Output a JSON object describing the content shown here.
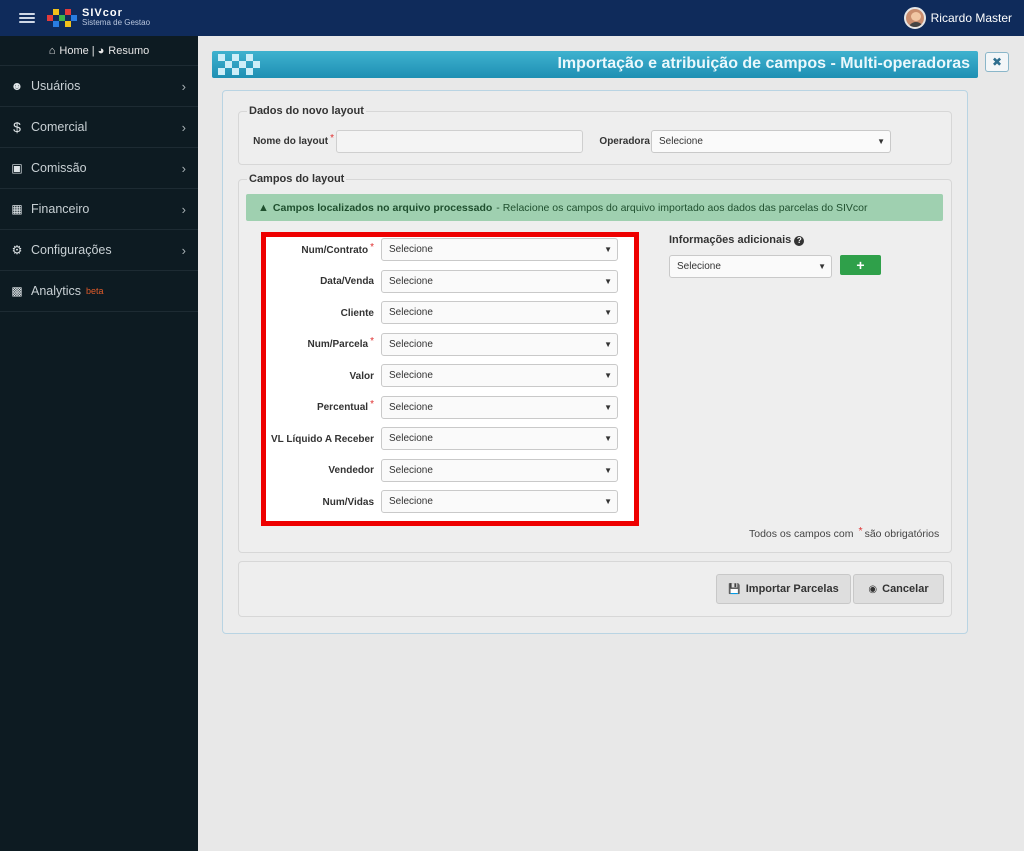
{
  "app": {
    "brand_name": "SIVcor",
    "brand_sub": "Sistema de Gestao",
    "user_name": "Ricardo Master"
  },
  "sidebar": {
    "home_label": "Home",
    "separator": "|",
    "summary_label": "Resumo",
    "items": [
      {
        "label": "Usuários",
        "icon": "users-icon"
      },
      {
        "label": "Comercial",
        "icon": "dollar-icon"
      },
      {
        "label": "Comissão",
        "icon": "money-icon"
      },
      {
        "label": "Financeiro",
        "icon": "briefcase-icon"
      },
      {
        "label": "Configurações",
        "icon": "gears-icon"
      },
      {
        "label": "Analytics",
        "icon": "bar-chart-icon",
        "badge": "beta"
      }
    ]
  },
  "page": {
    "title": "Importação e atribuição de campos - Multi-operadoras"
  },
  "new_layout": {
    "legend": "Dados do novo layout",
    "name_label": "Nome do layout",
    "name_value": "",
    "operator_label": "Operadora",
    "operator_value": "Selecione"
  },
  "layout_fields": {
    "legend": "Campos do layout",
    "alert_bold": "Campos localizados no arquivo processado",
    "alert_text": "- Relacione os campos do arquivo importado aos dados das parcelas do SIVcor",
    "fields": [
      {
        "label": "Num/Contrato",
        "required": true,
        "value": "Selecione"
      },
      {
        "label": "Data/Venda",
        "required": false,
        "value": "Selecione"
      },
      {
        "label": "Cliente",
        "required": false,
        "value": "Selecione"
      },
      {
        "label": "Num/Parcela",
        "required": true,
        "value": "Selecione"
      },
      {
        "label": "Valor",
        "required": false,
        "value": "Selecione"
      },
      {
        "label": "Percentual",
        "required": true,
        "value": "Selecione"
      },
      {
        "label": "VL Líquido A Receber",
        "required": false,
        "value": "Selecione"
      },
      {
        "label": "Vendedor",
        "required": false,
        "value": "Selecione"
      },
      {
        "label": "Num/Vidas",
        "required": false,
        "value": "Selecione"
      }
    ],
    "required_marker": "*",
    "additional_title": "Informações adicionais",
    "additional_value": "Selecione",
    "add_label": "+",
    "required_note_prefix": "Todos os campos com",
    "required_note_suffix": "são obrigatórios"
  },
  "actions": {
    "import_label": "Importar Parcelas",
    "cancel_label": "Cancelar"
  },
  "colors": {
    "navbar": "#0f2b5b",
    "sidebar": "#0d1b22",
    "header": "#1e8fb3",
    "alert": "#9fd0b0",
    "highlight": "#ee0000",
    "add_button": "#2fa04a",
    "required": "#e03030"
  }
}
